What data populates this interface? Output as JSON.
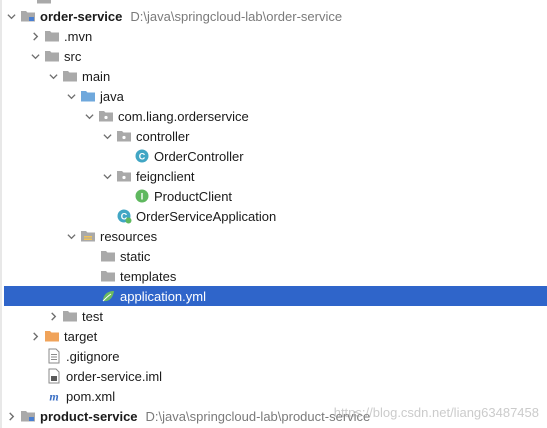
{
  "tree": {
    "root": {
      "name": "order-service",
      "path": "D:\\java\\springcloud-lab\\order-service"
    },
    "mvn": ".mvn",
    "src": "src",
    "main": "main",
    "java": "java",
    "package": "com.liang.orderservice",
    "controller": "controller",
    "order_controller": "OrderController",
    "feignclient": "feignclient",
    "product_client": "ProductClient",
    "application_class": "OrderServiceApplication",
    "resources": "resources",
    "static": "static",
    "templates": "templates",
    "application_yml": "application.yml",
    "test": "test",
    "target": "target",
    "gitignore": ".gitignore",
    "iml": "order-service.iml",
    "pom": "pom.xml",
    "product_service": {
      "name": "product-service",
      "path": "D:\\java\\springcloud-lab\\product-service"
    }
  },
  "watermark": "https://blog.csdn.net/liang63487458",
  "colors": {
    "selection": "#2f65ca",
    "folder": "#a9a9a9",
    "java_folder": "#6fa8dc",
    "target_folder": "#f0a35a",
    "class_icon": "#41a6c4",
    "interface_icon": "#5fb85f"
  }
}
